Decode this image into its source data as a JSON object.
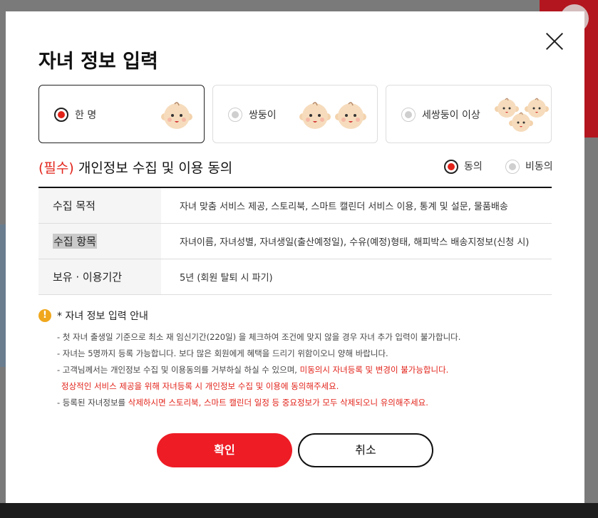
{
  "modal": {
    "title": "자녀 정보 입력",
    "close_icon": "close-icon"
  },
  "children_options": [
    {
      "label": "한 명",
      "selected": true,
      "count": 1
    },
    {
      "label": "쌍둥이",
      "selected": false,
      "count": 2
    },
    {
      "label": "세쌍둥이 이상",
      "selected": false,
      "count": 3
    }
  ],
  "consent": {
    "required_tag": "(필수)",
    "title": " 개인정보 수집 및 이용 동의",
    "agree_label": "동의",
    "disagree_label": "비동의",
    "agree_selected": true
  },
  "table": [
    {
      "header": "수집 목적",
      "value": "자녀 맞춤 서비스 제공, 스토리북, 스마트 캘린더 서비스 이용, 통계 및 설문, 물품배송"
    },
    {
      "header": "수집 항목",
      "value": "자녀이름, 자녀성별, 자녀생일(출산예정일), 수유(예정)형태, 해피박스 배송지정보(신청 시)"
    },
    {
      "header": "보유 · 이용기간",
      "value": "5년 (회원 탈퇴 시 파기)"
    }
  ],
  "notice": {
    "icon": "!",
    "title": "* 자녀 정보 입력 안내",
    "line1": "- 첫 자녀 출생일 기준으로 최소 재 임신기간(220일) 을 체크하여 조건에 맞지 않을 경우 자녀 추가 입력이 불가합니다.",
    "line2": "- 자녀는 5명까지 등록 가능합니다. 보다 많은 회원에게 혜택을 드리기 위함이오니 양해 바랍니다.",
    "line3a": "- 고객님께서는 개인정보 수집 및 이용동의를 거부하실 하실 수 있으며, ",
    "line3b": "미동의시 자녀등록 및 변경이 불가능합니다.",
    "line4": "정상적인 서비스 제공을 위해 자녀등록 시 개인정보 수집 및 이용에 동의해주세요.",
    "line5a": "- 등록된 자녀정보를 ",
    "line5b": "삭제하시면 스토리북, 스마트 캘린더 일정 등 중요정보가 모두 삭제되오니 유의해주세요."
  },
  "buttons": {
    "confirm": "확인",
    "cancel": "취소"
  },
  "colors": {
    "accent": "#e2231a",
    "button_red": "#ee1c25",
    "notice_icon": "#f0a71c"
  }
}
